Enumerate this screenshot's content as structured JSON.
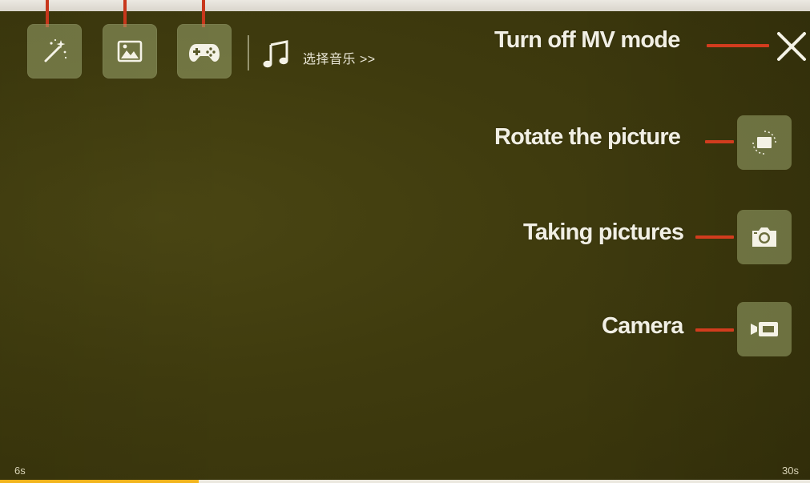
{
  "toolbar": {
    "tools": [
      {
        "icon": "magic-wand-icon"
      },
      {
        "icon": "picture-icon"
      },
      {
        "icon": "gamepad-icon"
      }
    ],
    "music": {
      "icon": "music-note-icon",
      "label": "选择音乐 >>"
    }
  },
  "controls": {
    "close": {
      "label": "Turn off MV mode",
      "icon": "close-icon"
    },
    "rotate": {
      "label": "Rotate the picture",
      "icon": "rotate-icon"
    },
    "photo": {
      "label": "Taking pictures",
      "icon": "camera-icon"
    },
    "video": {
      "label": "Camera",
      "icon": "video-camera-icon"
    }
  },
  "timeline": {
    "start": "6s",
    "end": "30s",
    "progress": 0.245
  },
  "colors": {
    "background": "#3f3a0d",
    "callout": "#d23c1e",
    "progress_fill": "#f2b51e",
    "button_bg": "#9ba56e"
  }
}
